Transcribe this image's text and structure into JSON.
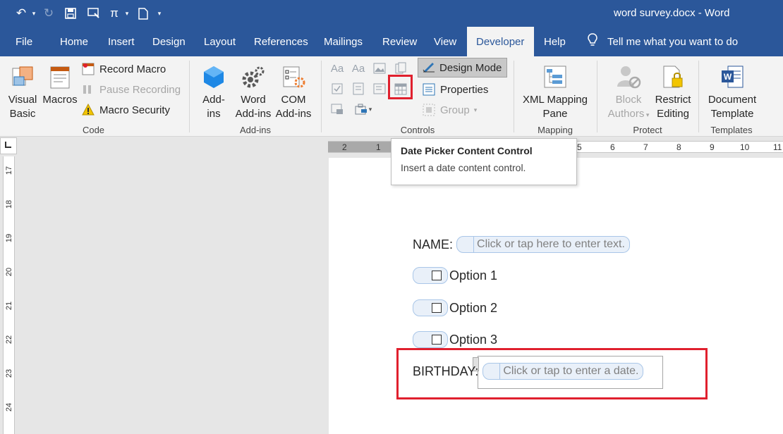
{
  "window": {
    "title": "word survey.docx  -  Word"
  },
  "qat": {
    "undo": "↶",
    "redo": "↻",
    "save": "💾",
    "pi": "π",
    "new_doc": "🗋"
  },
  "tabs": [
    {
      "label": "File"
    },
    {
      "label": "Home"
    },
    {
      "label": "Insert"
    },
    {
      "label": "Design"
    },
    {
      "label": "Layout"
    },
    {
      "label": "References"
    },
    {
      "label": "Mailings"
    },
    {
      "label": "Review"
    },
    {
      "label": "View"
    },
    {
      "label": "Developer",
      "active": true
    },
    {
      "label": "Help"
    }
  ],
  "tell_me": "Tell me what you want to do",
  "ribbon": {
    "code": {
      "label": "Code",
      "visual_basic": "Visual Basic",
      "visual_basic_l1": "Visual",
      "visual_basic_l2": "Basic",
      "macros": "Macros",
      "record_macro": "Record Macro",
      "pause_recording": "Pause Recording",
      "macro_security": "Macro Security"
    },
    "addins": {
      "label": "Add-ins",
      "addins_l1": "Add-",
      "addins_l2": "ins",
      "word_l1": "Word",
      "word_l2": "Add-ins",
      "com_l1": "COM",
      "com_l2": "Add-ins"
    },
    "controls": {
      "label": "Controls",
      "design_mode": "Design Mode",
      "properties": "Properties",
      "group": "Group"
    },
    "mapping": {
      "label": "Mapping",
      "xml_l1": "XML Mapping",
      "xml_l2": "Pane"
    },
    "protect": {
      "label": "Protect",
      "block_l1": "Block",
      "block_l2": "Authors",
      "restrict_l1": "Restrict",
      "restrict_l2": "Editing"
    },
    "templates": {
      "label": "Templates",
      "doc_l1": "Document",
      "doc_l2": "Template"
    }
  },
  "hruler": [
    "2",
    "1",
    "5",
    "6",
    "7",
    "8",
    "9",
    "10",
    "11"
  ],
  "vruler": [
    "17",
    "18",
    "19",
    "20",
    "21",
    "22",
    "23",
    "24"
  ],
  "tooltip": {
    "title": "Date Picker Content Control",
    "desc": "Insert a date content control."
  },
  "document": {
    "name_label": "NAME:",
    "name_placeholder": "Click or tap here to enter text.",
    "options": [
      "Option 1",
      "Option 2",
      "Option 3"
    ],
    "birthday_label": "BIRTHDAY:",
    "date_placeholder": "Click or tap to enter a date."
  },
  "colors": {
    "brand": "#2b579a",
    "highlight": "#e0202e"
  }
}
